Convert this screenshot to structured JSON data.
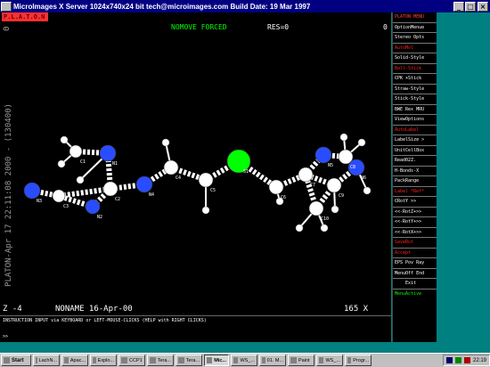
{
  "window": {
    "title": "MicroImages X Server   1024x740x24 bit   tech@microimages.com   Build Date: 19 Mar 1997"
  },
  "platon_header": "P.L.A.T.O.N",
  "canvas": {
    "status": "NOMOVE FORCED",
    "resolution": "RES=0",
    "top_right": "0",
    "top_left": "0 Y",
    "vertical_text": "PLATON-Apr 17 22:11:08 2000 - (130400)",
    "bottom_left": "Z -4",
    "bottom_middle": "NONAME 16-Apr-00",
    "bottom_right": "165 X"
  },
  "atom_labels": [
    "C1",
    "N1",
    "C2",
    "N2",
    "C3",
    "N3",
    "C4",
    "N4",
    "C5",
    "S1",
    "C6",
    "C7",
    "N5",
    "C8",
    "N6",
    "C9",
    "C10"
  ],
  "menu": [
    {
      "label": "PLATON MENU",
      "style": "hdr"
    },
    {
      "label": "OptionMenue",
      "style": "normal"
    },
    {
      "label": "Stereo Opts",
      "style": "normal"
    },
    {
      "label": "AutoMol",
      "style": "red"
    },
    {
      "label": "Solid-Style",
      "style": "normal"
    },
    {
      "label": "Ball-Stick",
      "style": "red"
    },
    {
      "label": "CPK  +Stick",
      "style": "normal"
    },
    {
      "label": "Straw-Style",
      "style": "normal"
    },
    {
      "label": "Stick-Style",
      "style": "normal"
    },
    {
      "label": "BWE Rex MRU",
      "style": "normal"
    },
    {
      "label": "ViewOptions",
      "style": "normal"
    },
    {
      "label": "AutoLabel",
      "style": "red"
    },
    {
      "label": "LabelSize >",
      "style": "normal"
    },
    {
      "label": "UnitCellBox",
      "style": "normal"
    },
    {
      "label": "Read02Z.",
      "style": "normal"
    },
    {
      "label": "H-Bonds-X",
      "style": "normal"
    },
    {
      "label": "PackRange",
      "style": "normal"
    },
    {
      "label": "Label *Ref*",
      "style": "red"
    },
    {
      "label": "CRotY >>",
      "style": "normal"
    },
    {
      "label": "<<-RotZ+>>",
      "style": "normal"
    },
    {
      "label": "<<-RotY+>>",
      "style": "normal"
    },
    {
      "label": "<<-RotX+>>",
      "style": "normal"
    },
    {
      "label": "SaveRot",
      "style": "red"
    },
    {
      "label": "Accept",
      "style": "red"
    },
    {
      "label": "EPS Pov Ray",
      "style": "normal"
    },
    {
      "label": "MenuOff End",
      "style": "normal"
    },
    {
      "label": "Exit",
      "style": "normal"
    },
    {
      "label": "MenuActive",
      "style": "green"
    }
  ],
  "instructions": {
    "text": "INSTRUCTION INPUT via KEYBOARD or LEFT-MOUSE-CLICKS (HELP with RIGHT CLICKS)",
    "prompt": ">>"
  },
  "taskbar": {
    "start": "Start",
    "items": [
      "LachN...",
      "Apac...",
      "Explo...",
      "CCP1",
      "Tera...",
      "Tera...",
      "Mic...",
      "WS_...",
      "01. M...",
      "Paint",
      "WS_...",
      "Progr..."
    ],
    "active_index": 6,
    "clock": "22:19"
  },
  "colors": {
    "nitrogen": "#2a4cff",
    "sulfur": "#00ff00",
    "carbon": "#ffffff"
  }
}
